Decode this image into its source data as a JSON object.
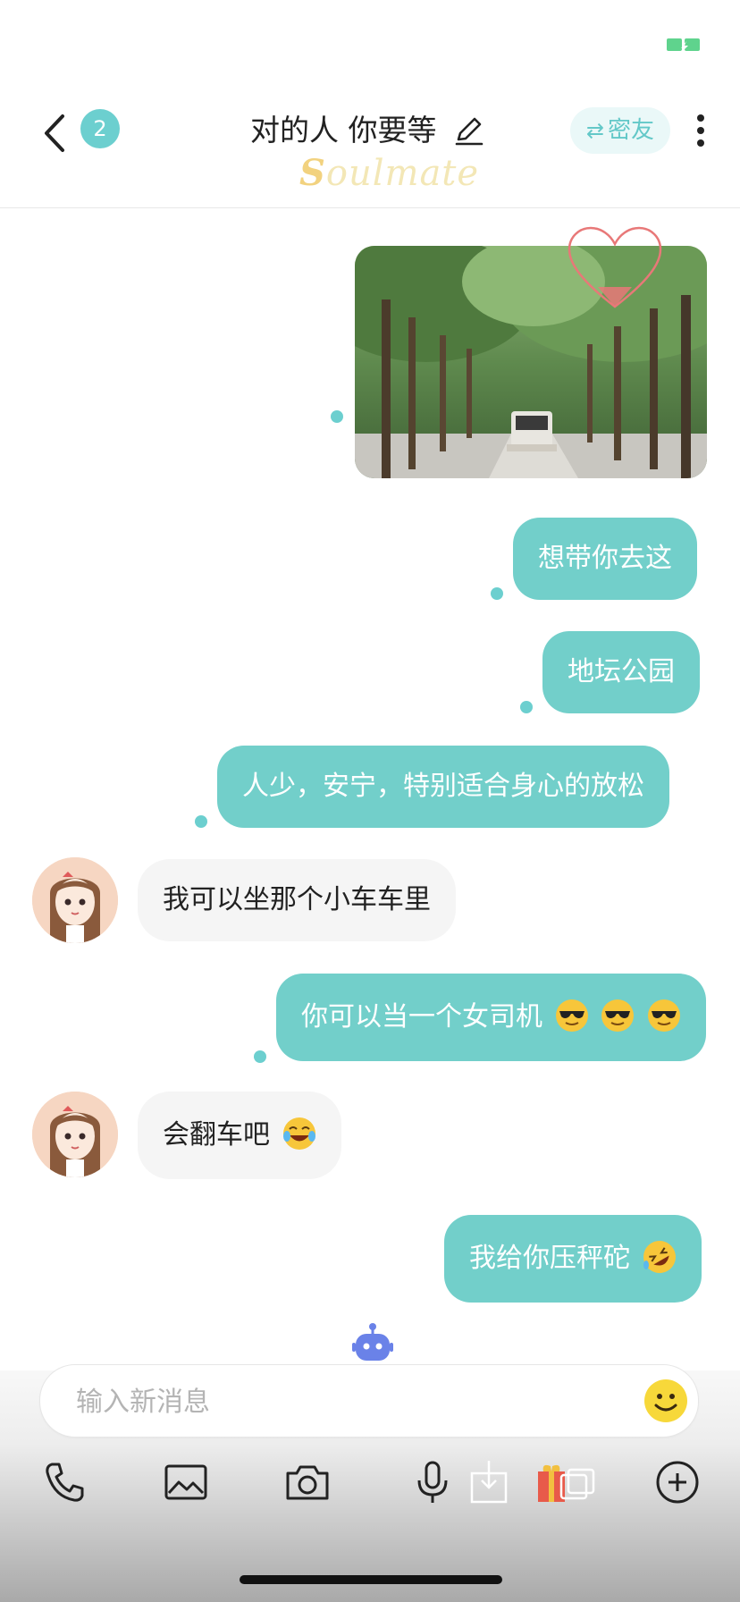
{
  "header": {
    "unread_count": "2",
    "title": "对的人 你要等",
    "watermark": "Soulmate",
    "friend_button_label": "密友",
    "back_icon": "chevron-left-icon",
    "edit_icon": "pencil-icon",
    "more_icon": "more-vertical-icon"
  },
  "messages": [
    {
      "type": "image",
      "from": "me",
      "description_icon": "photo-tree-lane"
    },
    {
      "type": "text",
      "from": "me",
      "text": "想带你去这"
    },
    {
      "type": "text",
      "from": "me",
      "text": "地坛公园"
    },
    {
      "type": "text",
      "from": "me",
      "text": "人少，安宁，特别适合身心的放松"
    },
    {
      "type": "text",
      "from": "them",
      "text": "我可以坐那个小车车里"
    },
    {
      "type": "text",
      "from": "me",
      "text": "你可以当一个女司机",
      "emoji": "sunglasses-emoji x3"
    },
    {
      "type": "text",
      "from": "them",
      "text": "会翻车吧",
      "emoji": "tears-of-joy-emoji"
    },
    {
      "type": "text",
      "from": "me",
      "text": "我给你压秤砣",
      "emoji": "rolling-laughing-emoji"
    }
  ],
  "input": {
    "placeholder": "输入新消息"
  },
  "toolbar": {
    "items": [
      "phone-icon",
      "image-icon",
      "camera-icon",
      "microphone-icon",
      "gift-icon",
      "plus-icon"
    ]
  },
  "colors": {
    "accent": "#72cfca",
    "incoming_bubble": "#f5f5f5"
  }
}
